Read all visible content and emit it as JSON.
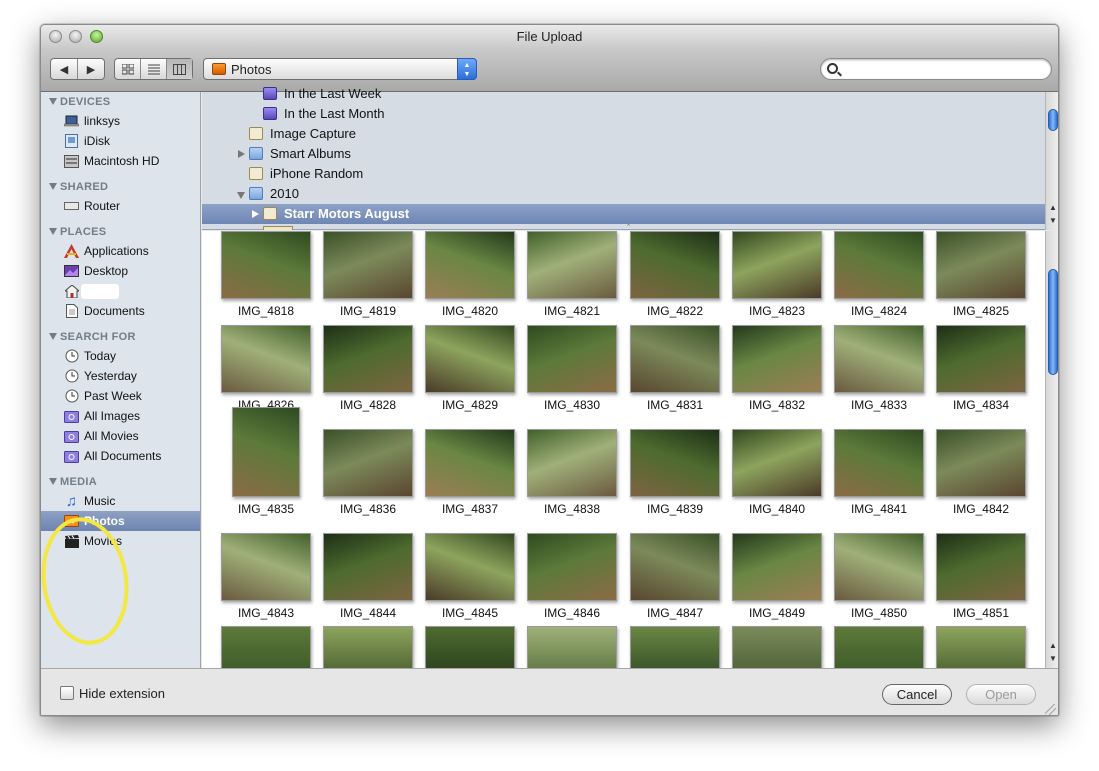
{
  "window": {
    "title": "File Upload"
  },
  "toolbar": {
    "nav_back": "◀",
    "nav_forward": "▶",
    "location": "Photos",
    "search_value": "",
    "search_placeholder": ""
  },
  "sidebar": {
    "sections": [
      {
        "title": "DEVICES",
        "items": [
          {
            "label": "linksys",
            "icon": "laptop-icon"
          },
          {
            "label": "iDisk",
            "icon": "idisk-icon"
          },
          {
            "label": "Macintosh HD",
            "icon": "harddrive-icon"
          }
        ]
      },
      {
        "title": "SHARED",
        "items": [
          {
            "label": "Router",
            "icon": "network-device-icon"
          }
        ]
      },
      {
        "title": "PLACES",
        "items": [
          {
            "label": "Applications",
            "icon": "applications-icon"
          },
          {
            "label": "Desktop",
            "icon": "desktop-icon"
          },
          {
            "label": "",
            "icon": "home-icon"
          },
          {
            "label": "Documents",
            "icon": "documents-icon"
          }
        ]
      },
      {
        "title": "SEARCH FOR",
        "items": [
          {
            "label": "Today",
            "icon": "clock-icon"
          },
          {
            "label": "Yesterday",
            "icon": "clock-icon"
          },
          {
            "label": "Past Week",
            "icon": "clock-icon"
          },
          {
            "label": "All Images",
            "icon": "smart-folder-icon"
          },
          {
            "label": "All Movies",
            "icon": "smart-folder-icon"
          },
          {
            "label": "All Documents",
            "icon": "smart-folder-icon"
          }
        ]
      },
      {
        "title": "MEDIA",
        "items": [
          {
            "label": "Music",
            "icon": "music-note-icon"
          },
          {
            "label": "Photos",
            "icon": "photos-icon",
            "selected": true
          },
          {
            "label": "Movies",
            "icon": "clapperboard-icon"
          }
        ]
      }
    ]
  },
  "browser": {
    "rows": [
      {
        "label": "In the Last Week",
        "type": "smart"
      },
      {
        "label": "In the Last Month",
        "type": "smart"
      },
      {
        "label": "Image Capture",
        "type": "album"
      },
      {
        "label": "Smart Albums",
        "type": "folder"
      },
      {
        "label": "iPhone Random",
        "type": "album"
      },
      {
        "label": "2010",
        "type": "folder"
      },
      {
        "label": "Starr Motors August",
        "type": "album",
        "selected": true
      }
    ]
  },
  "photos": [
    "IMG_4818",
    "IMG_4819",
    "IMG_4820",
    "IMG_4821",
    "IMG_4822",
    "IMG_4823",
    "IMG_4824",
    "IMG_4825",
    "IMG_4826",
    "IMG_4828",
    "IMG_4829",
    "IMG_4830",
    "IMG_4831",
    "IMG_4832",
    "IMG_4833",
    "IMG_4834",
    "IMG_4835",
    "IMG_4836",
    "IMG_4837",
    "IMG_4838",
    "IMG_4839",
    "IMG_4840",
    "IMG_4841",
    "IMG_4842",
    "IMG_4843",
    "IMG_4844",
    "IMG_4845",
    "IMG_4846",
    "IMG_4847",
    "IMG_4849",
    "IMG_4850",
    "IMG_4851"
  ],
  "footer": {
    "hide_extension_label": "Hide extension",
    "hide_extension_checked": false,
    "cancel_label": "Cancel",
    "open_label": "Open"
  },
  "colors": {
    "selection": "#7488b6",
    "scroll_thumb": "#3b7de0",
    "annotation_circle": "#f3e742",
    "sidebar_bg": "#dde4eb"
  }
}
